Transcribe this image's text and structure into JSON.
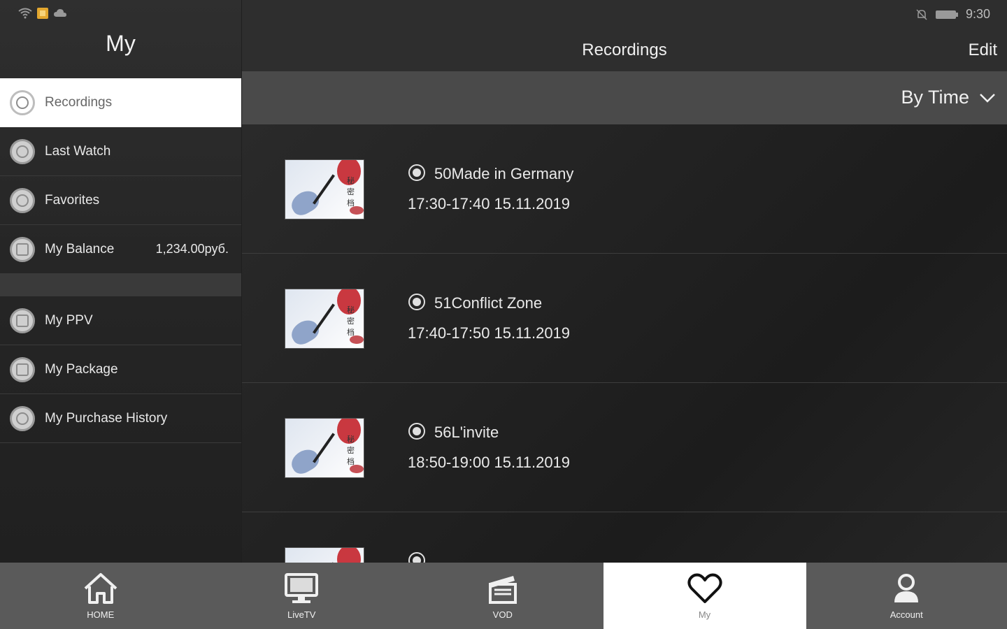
{
  "status_bar": {
    "time": "9:30"
  },
  "sidebar": {
    "title": "My",
    "items": [
      {
        "label": "Recordings",
        "active": true
      },
      {
        "label": "Last Watch"
      },
      {
        "label": "Favorites"
      },
      {
        "label": "My Balance",
        "value": "1,234.00руб."
      }
    ],
    "items2": [
      {
        "label": "My PPV"
      },
      {
        "label": "My Package"
      },
      {
        "label": "My Purchase History"
      }
    ]
  },
  "main": {
    "title": "Recordings",
    "edit_label": "Edit",
    "sort_label": "By Time",
    "recordings": [
      {
        "title": "50Made in Germany",
        "time": "17:30-17:40 15.11.2019"
      },
      {
        "title": "51Conflict Zone",
        "time": "17:40-17:50 15.11.2019"
      },
      {
        "title": "56L'invite",
        "time": "18:50-19:00 15.11.2019"
      },
      {
        "title": "",
        "time": ""
      }
    ]
  },
  "bottom_nav": [
    {
      "label": "HOME",
      "icon": "home-icon"
    },
    {
      "label": "LiveTV",
      "icon": "tv-icon"
    },
    {
      "label": "VOD",
      "icon": "clapperboard-icon"
    },
    {
      "label": "My",
      "icon": "heart-icon",
      "active": true
    },
    {
      "label": "Account",
      "icon": "user-icon"
    }
  ]
}
